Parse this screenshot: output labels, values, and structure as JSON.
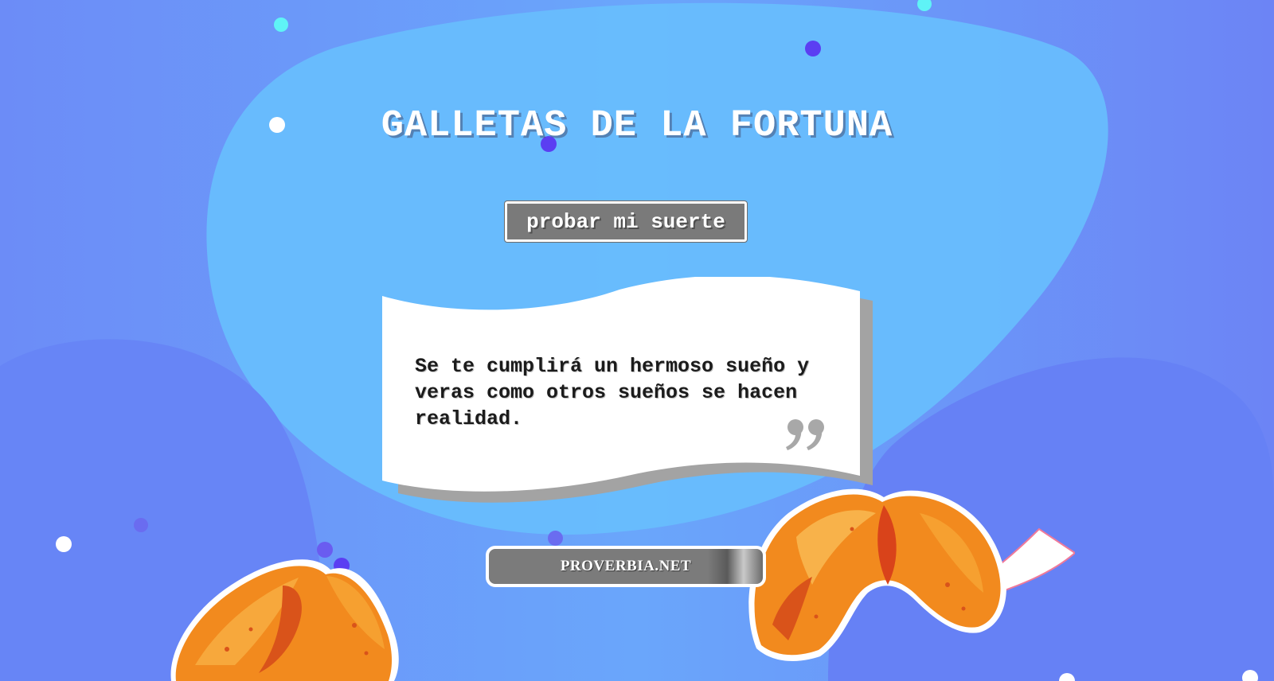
{
  "header": {
    "title": "GALLETAS DE LA FORTUNA"
  },
  "actions": {
    "try_luck_label": "probar mi suerte"
  },
  "fortune": {
    "message": "Se te cumplirá un hermoso sueño y veras como otros sueños se hacen realidad.",
    "quote_icon": "closing-quote-icon"
  },
  "source": {
    "label": "PROVERBIA.NET"
  },
  "colors": {
    "background": "#6a86f6",
    "blob_light": "#67bffd",
    "paper": "#ffffff",
    "paper_shadow": "#a3a3a3",
    "button_gray": "#7a7a7a",
    "cookie_orange": "#f28a1e",
    "dot_cyan": "#5ff3f6",
    "dot_purple": "#5b3ef2",
    "dot_white": "#ffffff"
  },
  "decorations": {
    "left_cookie": "fortune-cookie-illustration",
    "right_cookie": "fortune-cookie-with-paper-illustration"
  }
}
